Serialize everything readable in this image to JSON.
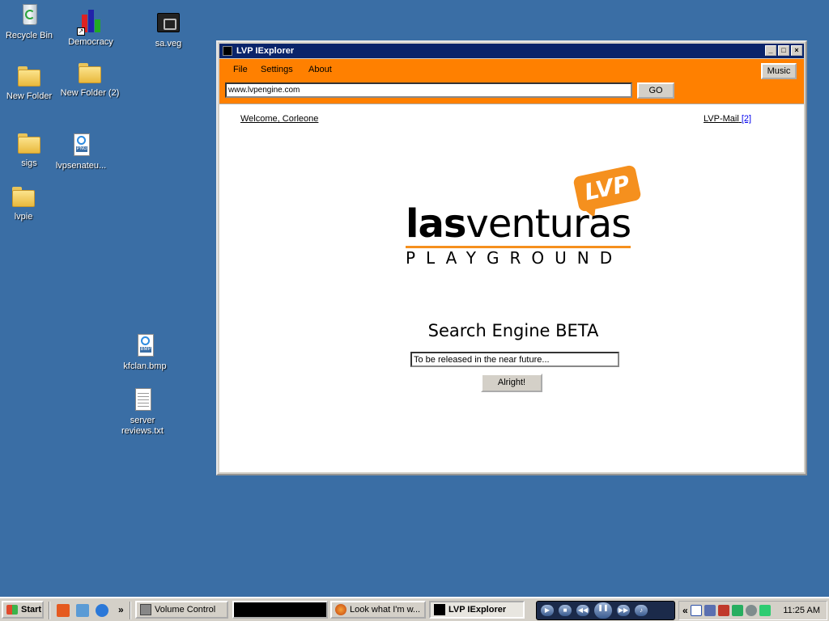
{
  "desktop": {
    "icons": {
      "recycle_bin": "Recycle Bin",
      "democracy": "Democracy",
      "sa_veg": "sa.veg",
      "new_folder": "New Folder",
      "new_folder_2": "New Folder (2)",
      "sigs": "sigs",
      "lvpsenate": "lvpsenateu...",
      "lvpie": "lvpie",
      "kfclan": "kfclan.bmp",
      "server_reviews_1": "server",
      "server_reviews_2": "reviews.txt"
    }
  },
  "window": {
    "title": "LVP IExplorer",
    "controls": {
      "minimize": "_",
      "maximize": "□",
      "close": "×"
    },
    "menu": {
      "file": "File",
      "settings": "Settings",
      "about": "About",
      "music": "Music"
    },
    "address": {
      "value": "www.lvpengine.com",
      "go_label": "GO"
    },
    "content": {
      "welcome": "Welcome, Corleone",
      "mail_label": "LVP-Mail",
      "mail_count": "[2]",
      "logo": {
        "badge": "LVP",
        "las": "las",
        "venturas": "venturas",
        "playground": "PLAYGROUND"
      },
      "subtitle": "Search Engine BETA",
      "search_value": "To be released in the near future...",
      "submit_label": "Alright!"
    }
  },
  "taskbar": {
    "start_label": "Start",
    "more_label": "»",
    "buttons": {
      "volume": "Volume Control",
      "firefox": "Look what I'm w...",
      "lvp": "LVP IExplorer"
    },
    "tray_more": "«",
    "clock": "11:25 AM"
  },
  "colors": {
    "desktop": "#3a6ea5",
    "titlebar": "#0a246a",
    "toolbar_orange": "#ff8000",
    "logo_orange": "#f5901e"
  }
}
